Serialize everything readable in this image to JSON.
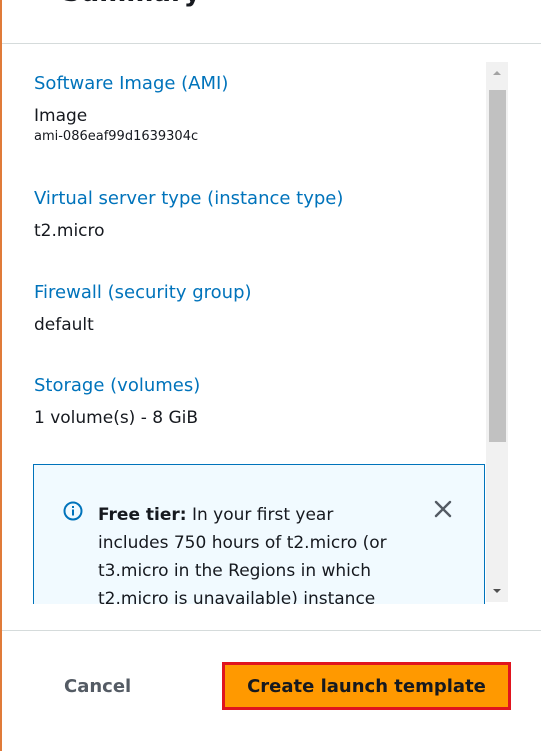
{
  "header": {
    "title": "Summary"
  },
  "summary": {
    "ami": {
      "label": "Software Image (AMI)",
      "value": "Image",
      "id": "ami-086eaf99d1639304c"
    },
    "instance_type": {
      "label": "Virtual server type (instance type)",
      "value": "t2.micro"
    },
    "firewall": {
      "label": "Firewall (security group)",
      "value": "default"
    },
    "storage": {
      "label": "Storage (volumes)",
      "value": "1 volume(s) - 8 GiB"
    }
  },
  "free_tier": {
    "title": "Free tier:",
    "line1": "In your first year",
    "line2": "includes 750 hours of t2.micro (or",
    "line3": "t3.micro in the Regions in which",
    "line4": "t2.micro is unavailable) instance"
  },
  "footer": {
    "cancel_label": "Cancel",
    "create_label": "Create launch template"
  },
  "colors": {
    "link": "#0073bb",
    "primary": "#ff9900",
    "highlight": "#e0141e"
  }
}
